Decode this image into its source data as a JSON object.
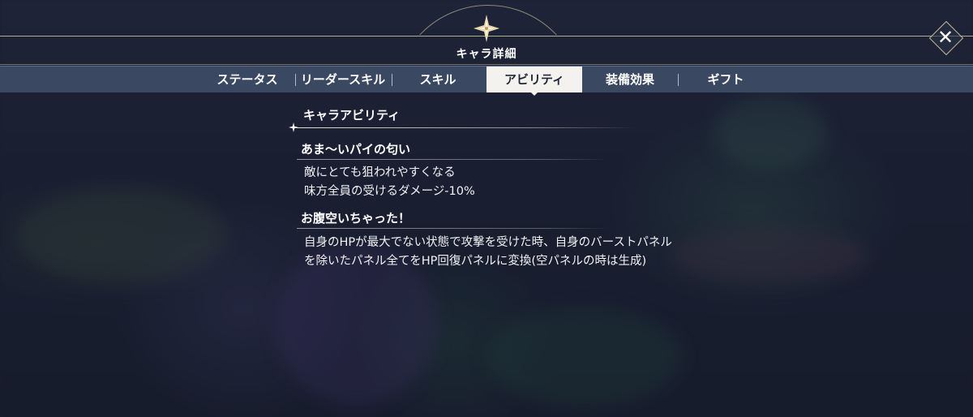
{
  "header": {
    "title": "キャラ詳細",
    "close_icon": "close-icon"
  },
  "tabs": [
    {
      "label": "ステータス",
      "active": false
    },
    {
      "label": "リーダースキル",
      "active": false
    },
    {
      "label": "スキル",
      "active": false
    },
    {
      "label": "アビリティ",
      "active": true
    },
    {
      "label": "装備効果",
      "active": false
    },
    {
      "label": "ギフト",
      "active": false
    }
  ],
  "section": {
    "title": "キャラアビリティ"
  },
  "abilities": [
    {
      "name": "あま～いパイの匂い",
      "lines": [
        "敵にとても狙われやすくなる",
        "味方全員の受けるダメージ-10%"
      ]
    },
    {
      "name": "お腹空いちゃった！",
      "lines": [
        "自身のHPが最大でない状態で攻撃を受けた時、自身のバーストパネル",
        "を除いたパネル全てをHP回復パネルに変換(空パネルの時は生成)"
      ]
    }
  ],
  "colors": {
    "accent_gold": "#e6d7aa",
    "tab_active_bg": "#f4f2ee",
    "tabbar_bg": "#46566f"
  }
}
